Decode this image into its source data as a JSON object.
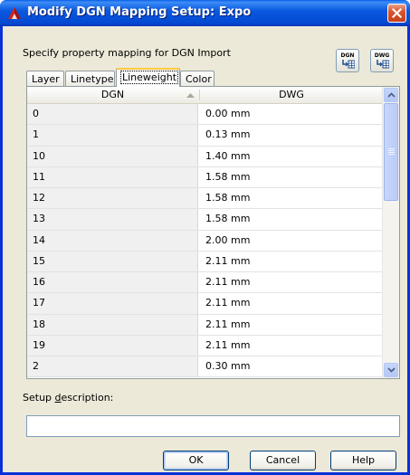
{
  "window": {
    "title": "Modify DGN Mapping Setup: Expo"
  },
  "instruction": "Specify property mapping for DGN Import",
  "tool_buttons": [
    {
      "caption": "DGN",
      "icon": "import-dgn-icon"
    },
    {
      "caption": "DWG",
      "icon": "import-dwg-icon"
    }
  ],
  "tabs": [
    {
      "label": "Layer"
    },
    {
      "label": "Linetype"
    },
    {
      "label": "Lineweight",
      "active": true
    },
    {
      "label": "Color"
    }
  ],
  "grid": {
    "columns": [
      "DGN",
      "DWG"
    ],
    "sort_indicator": "ascending",
    "rows": [
      {
        "dgn": "0",
        "dwg": "0.00 mm"
      },
      {
        "dgn": "1",
        "dwg": "0.13 mm"
      },
      {
        "dgn": "10",
        "dwg": "1.40 mm"
      },
      {
        "dgn": "11",
        "dwg": "1.58 mm"
      },
      {
        "dgn": "12",
        "dwg": "1.58 mm"
      },
      {
        "dgn": "13",
        "dwg": "1.58 mm"
      },
      {
        "dgn": "14",
        "dwg": "2.00 mm"
      },
      {
        "dgn": "15",
        "dwg": "2.11 mm"
      },
      {
        "dgn": "16",
        "dwg": "2.11 mm"
      },
      {
        "dgn": "17",
        "dwg": "2.11 mm"
      },
      {
        "dgn": "18",
        "dwg": "2.11 mm"
      },
      {
        "dgn": "19",
        "dwg": "2.11 mm"
      },
      {
        "dgn": "2",
        "dwg": "0.30 mm"
      }
    ]
  },
  "setup_description": {
    "label_pre": "Setup ",
    "label_accel": "d",
    "label_post": "escription:",
    "value": ""
  },
  "buttons": {
    "ok": "OK",
    "cancel": "Cancel",
    "help": "Help"
  },
  "colors": {
    "titlebar": "#0A5FE8",
    "dialog_bg": "#ECE9D8",
    "frame": "#0831D9",
    "active_tab_accent": "#FFC73C"
  }
}
